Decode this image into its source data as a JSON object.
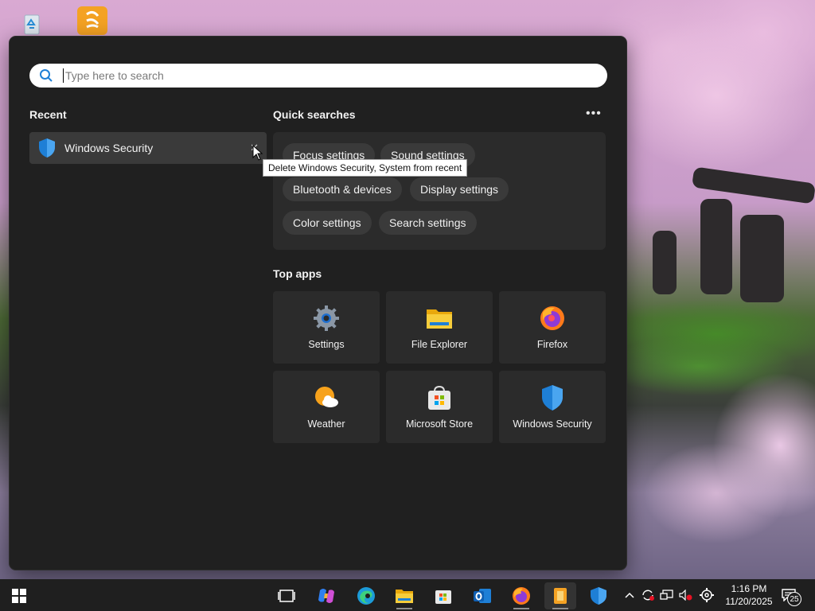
{
  "search": {
    "placeholder": "Type here to search"
  },
  "recent": {
    "title": "Recent",
    "items": [
      {
        "label": "Windows Security",
        "icon": "shield-icon"
      }
    ],
    "tooltip": "Delete Windows Security, System from recent"
  },
  "quick_searches": {
    "title": "Quick searches",
    "more_label": "•••",
    "chips": [
      "Focus settings",
      "Sound settings",
      "Bluetooth & devices",
      "Display settings",
      "Color settings",
      "Search settings"
    ]
  },
  "top_apps": {
    "title": "Top apps",
    "apps": [
      {
        "label": "Settings",
        "icon": "gear-icon"
      },
      {
        "label": "File Explorer",
        "icon": "folder-icon"
      },
      {
        "label": "Firefox",
        "icon": "firefox-icon"
      },
      {
        "label": "Weather",
        "icon": "weather-icon"
      },
      {
        "label": "Microsoft Store",
        "icon": "store-icon"
      },
      {
        "label": "Windows Security",
        "icon": "shield-icon"
      }
    ]
  },
  "taskbar": {
    "time": "1:16 PM",
    "date": "11/20/2025",
    "notification_count": "25",
    "pinned": [
      "task-view-icon",
      "copilot-icon",
      "edge-icon",
      "file-explorer-icon",
      "microsoft-store-icon",
      "outlook-icon",
      "firefox-icon",
      "notes-app-icon",
      "windows-security-icon"
    ]
  },
  "colors": {
    "panel_bg": "#202020",
    "tile_bg": "#2b2b2b",
    "chip_bg": "#3a3a3a",
    "accent_blue": "#1e7fd6",
    "taskbar_bg": "#1f1f1f"
  }
}
